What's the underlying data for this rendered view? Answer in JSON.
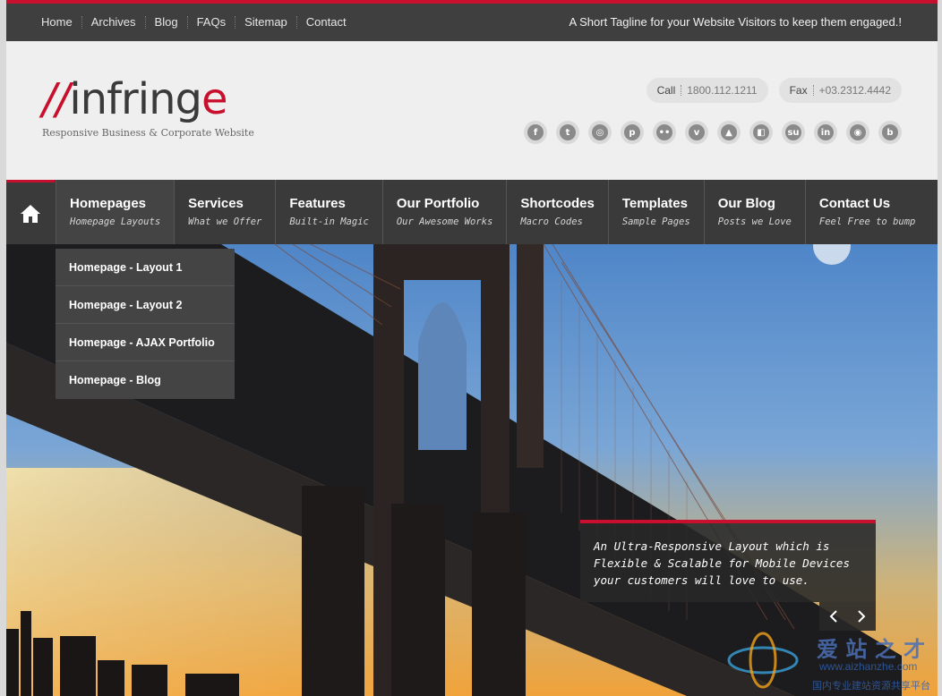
{
  "topbar": {
    "links": [
      "Home",
      "Archives",
      "Blog",
      "FAQs",
      "Sitemap",
      "Contact"
    ],
    "tagline": "A Short Tagline for your Website Visitors to keep them engaged.!"
  },
  "header": {
    "logo_slash": "//",
    "logo_name": "infring",
    "logo_accent": "e",
    "logo_subtitle": "Responsive Business & Corporate Website",
    "call_label": "Call",
    "call_value": "1800.112.1211",
    "fax_label": "Fax",
    "fax_value": "+03.2312.4442",
    "socials": [
      {
        "icon": "facebook-icon",
        "glyph": "f"
      },
      {
        "icon": "twitter-icon",
        "glyph": "t"
      },
      {
        "icon": "dribbble-icon",
        "glyph": "◎"
      },
      {
        "icon": "pinterest-icon",
        "glyph": "p"
      },
      {
        "icon": "flickr-icon",
        "glyph": "••"
      },
      {
        "icon": "vimeo-icon",
        "glyph": "v"
      },
      {
        "icon": "forrst-icon",
        "glyph": "▲"
      },
      {
        "icon": "delicious-icon",
        "glyph": "◧"
      },
      {
        "icon": "stumbleupon-icon",
        "glyph": "su"
      },
      {
        "icon": "linkedin-icon",
        "glyph": "in"
      },
      {
        "icon": "picasa-icon",
        "glyph": "◉"
      },
      {
        "icon": "blogger-icon",
        "glyph": "b"
      }
    ]
  },
  "nav": {
    "items": [
      {
        "title": "Homepages",
        "sub": "Homepage Layouts"
      },
      {
        "title": "Services",
        "sub": "What we Offer"
      },
      {
        "title": "Features",
        "sub": "Built-in Magic"
      },
      {
        "title": "Our Portfolio",
        "sub": "Our Awesome Works"
      },
      {
        "title": "Shortcodes",
        "sub": "Macro Codes"
      },
      {
        "title": "Templates",
        "sub": "Sample Pages"
      },
      {
        "title": "Our Blog",
        "sub": "Posts we Love"
      },
      {
        "title": "Contact Us",
        "sub": "Feel Free to bump"
      }
    ],
    "dropdown": [
      "Homepage - Layout 1",
      "Homepage - Layout 2",
      "Homepage - AJAX Portfolio",
      "Homepage - Blog"
    ]
  },
  "hero": {
    "caption_lines": [
      "An Ultra-Responsive Layout which is",
      "Flexible & Scalable for Mobile Devices",
      "your customers will love to use."
    ]
  },
  "watermark": {
    "brand": "爱 站 之 才",
    "url": "www.aizhanzhe.com",
    "slogan": "国内专业建站资源共享平台"
  },
  "colors": {
    "accent": "#c8102e",
    "dark": "#3a3a3a"
  }
}
